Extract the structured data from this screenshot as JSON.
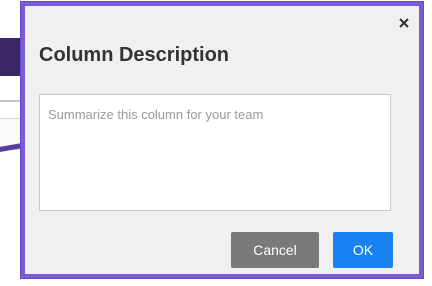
{
  "dialog": {
    "title": "Column Description",
    "close_glyph": "×",
    "close_icon": "close-icon",
    "description": {
      "placeholder": "Summarize this column for your team",
      "value": ""
    },
    "buttons": {
      "cancel_label": "Cancel",
      "ok_label": "OK"
    }
  },
  "colors": {
    "dialog_border": "#7b5bd6",
    "dialog_background": "#f0f0f0",
    "cancel_button": "#7a7a7a",
    "ok_button": "#1a82f0"
  }
}
